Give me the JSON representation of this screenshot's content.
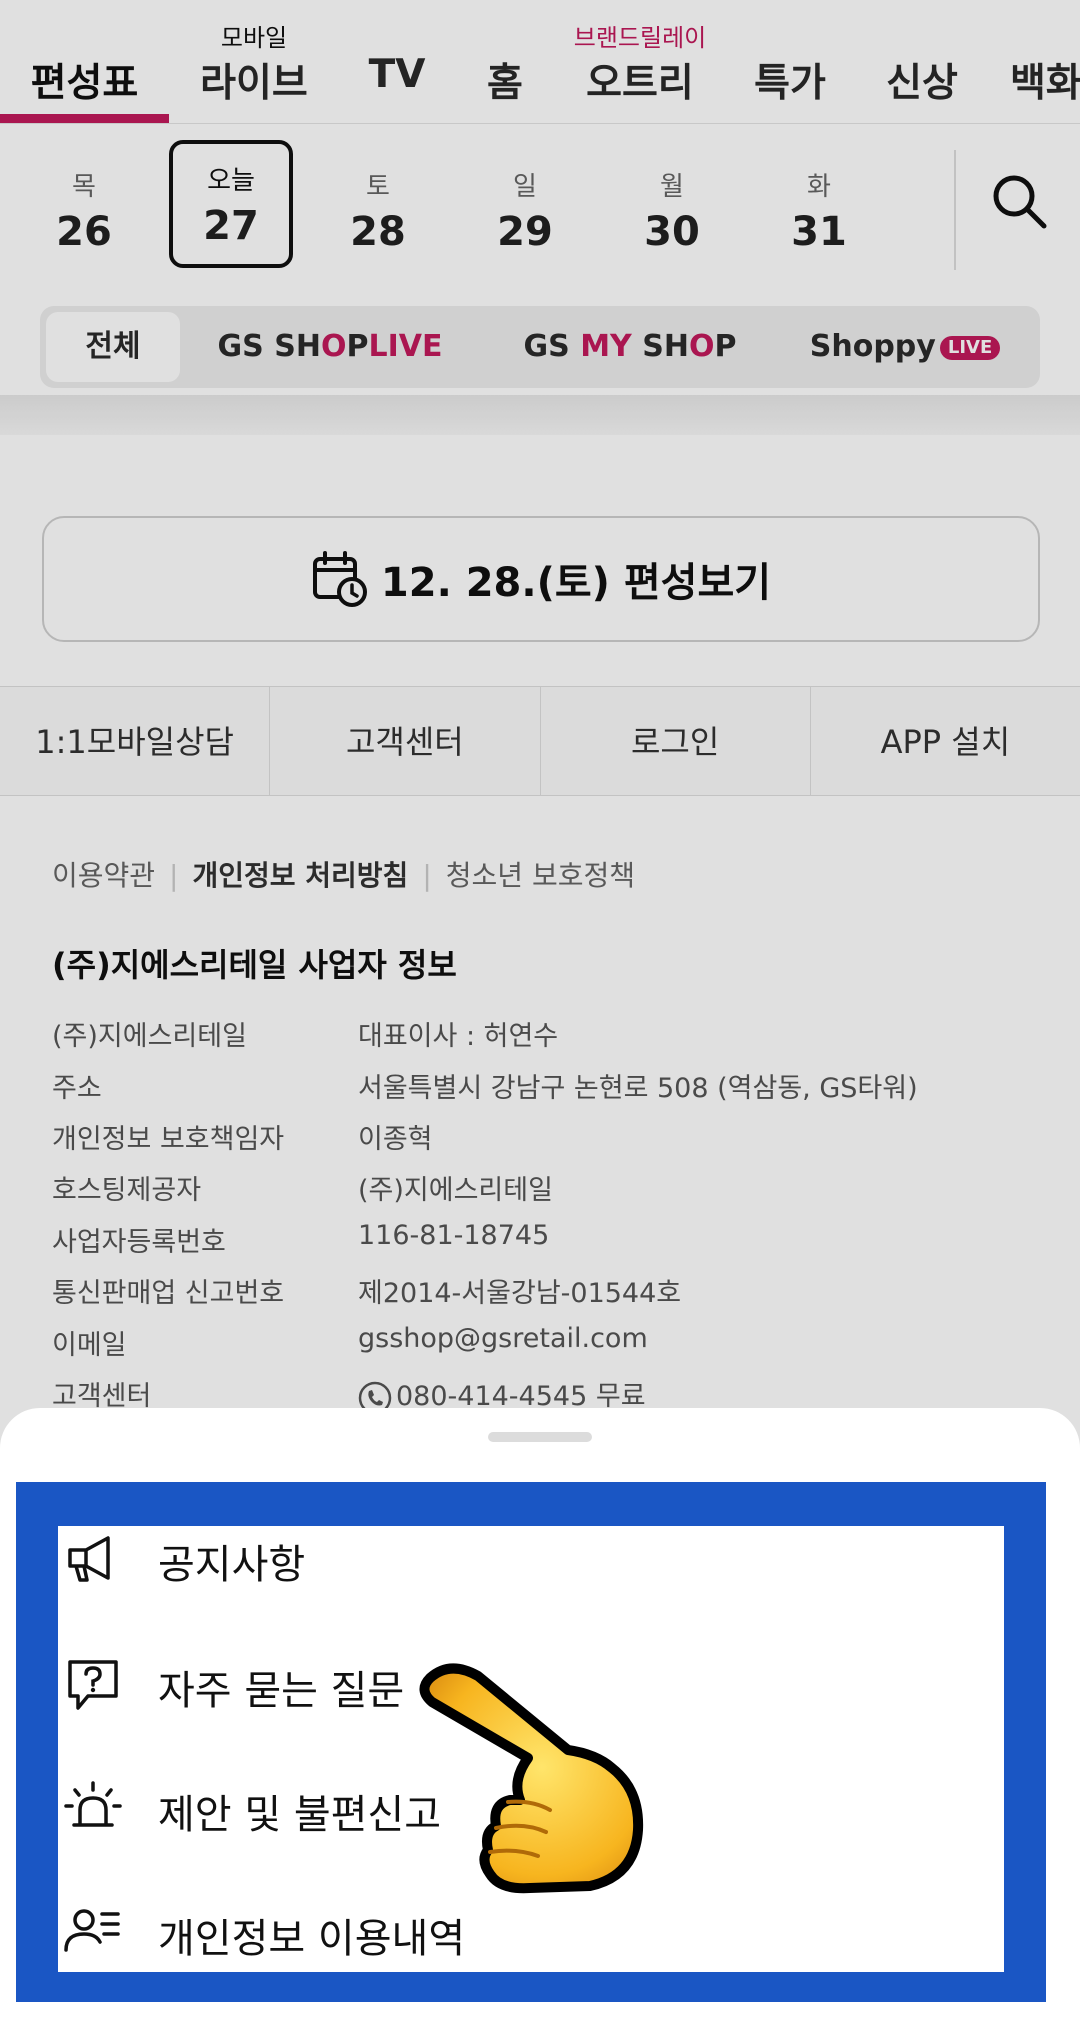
{
  "topnav": {
    "items": [
      {
        "label": "편성표",
        "sup": ""
      },
      {
        "label": "라이브",
        "sup": "모바일"
      },
      {
        "label": "TV",
        "sup": ""
      },
      {
        "label": "홈",
        "sup": ""
      },
      {
        "label": "오트리",
        "sup": "브랜드릴레이"
      },
      {
        "label": "특가",
        "sup": ""
      },
      {
        "label": "신상",
        "sup": ""
      },
      {
        "label": "백화",
        "sup": ""
      }
    ]
  },
  "dates": [
    {
      "dow": "목",
      "num": "26"
    },
    {
      "dow": "오늘",
      "num": "27"
    },
    {
      "dow": "토",
      "num": "28"
    },
    {
      "dow": "일",
      "num": "29"
    },
    {
      "dow": "월",
      "num": "30"
    },
    {
      "dow": "화",
      "num": "31"
    }
  ],
  "channels": {
    "all": "전체",
    "gs_shop_live": {
      "a": "GS SH",
      "b": "O",
      "c": "P",
      "d": "LIVE"
    },
    "gs_my_shop": {
      "a": "GS ",
      "b": "MY",
      "c": " SH",
      "d": "O",
      "e": "P"
    },
    "shoppy": {
      "name": "Shoppy",
      "live": "LIVE"
    }
  },
  "schedule_button": "12. 28.(토) 편성보기",
  "footer_links": [
    "1:1모바일상담",
    "고객센터",
    "로그인",
    "APP 설치"
  ],
  "policies": [
    "이용약관",
    "개인정보 처리방침",
    "청소년 보호정책"
  ],
  "business": {
    "title": "(주)지에스리테일 사업자 정보",
    "rows": [
      {
        "k": "(주)지에스리테일",
        "v": "대표이사 : 허연수"
      },
      {
        "k": "주소",
        "v": "서울특별시 강남구 논현로 508 (역삼동, GS타워)"
      },
      {
        "k": "개인정보 보호책임자",
        "v": "이종혁"
      },
      {
        "k": "호스팅제공자",
        "v": "(주)지에스리테일"
      },
      {
        "k": "사업자등록번호",
        "v": "116-81-18745"
      },
      {
        "k": "통신판매업 신고번호",
        "v": "제2014-서울강남-01544호"
      },
      {
        "k": "이메일",
        "v": "gsshop@gsretail.com"
      },
      {
        "k": "고객센터",
        "v": "080-414-4545 무료"
      }
    ]
  },
  "sheet": {
    "items": [
      {
        "label": "공지사항",
        "icon": "megaphone-icon"
      },
      {
        "label": "자주 묻는 질문",
        "icon": "question-bubble-icon"
      },
      {
        "label": "제안 및 불편신고",
        "icon": "siren-icon"
      },
      {
        "label": "개인정보 이용내역",
        "icon": "person-list-icon"
      }
    ]
  },
  "colors": {
    "accent": "#c21a5c",
    "frame": "#1a56c4"
  }
}
